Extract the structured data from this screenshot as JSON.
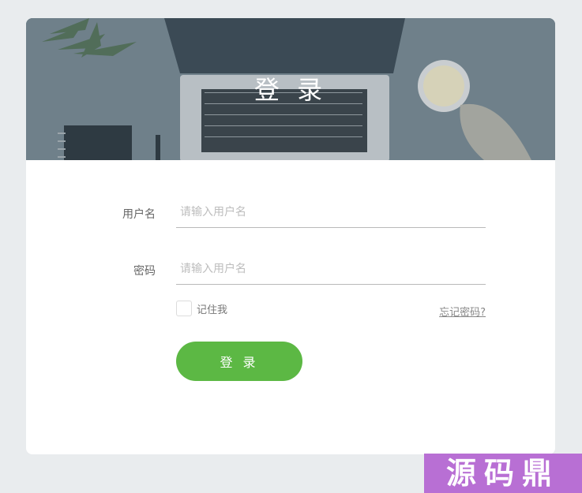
{
  "header": {
    "title": "登 录"
  },
  "form": {
    "username": {
      "label": "用户名",
      "placeholder": "请输入用户名",
      "value": ""
    },
    "password": {
      "label": "密码",
      "placeholder": "请输入用户名",
      "value": ""
    },
    "remember": {
      "label": "记住我",
      "checked": false
    },
    "forgot_label": "忘记密码?",
    "submit_label": "登 录"
  },
  "watermark": {
    "text": "源码鼎"
  },
  "colors": {
    "page_bg": "#e9ecee",
    "card_bg": "#ffffff",
    "banner_overlay": "#6e7f89",
    "accent_green": "#5cb844",
    "watermark_purple": "#b86fd4"
  }
}
